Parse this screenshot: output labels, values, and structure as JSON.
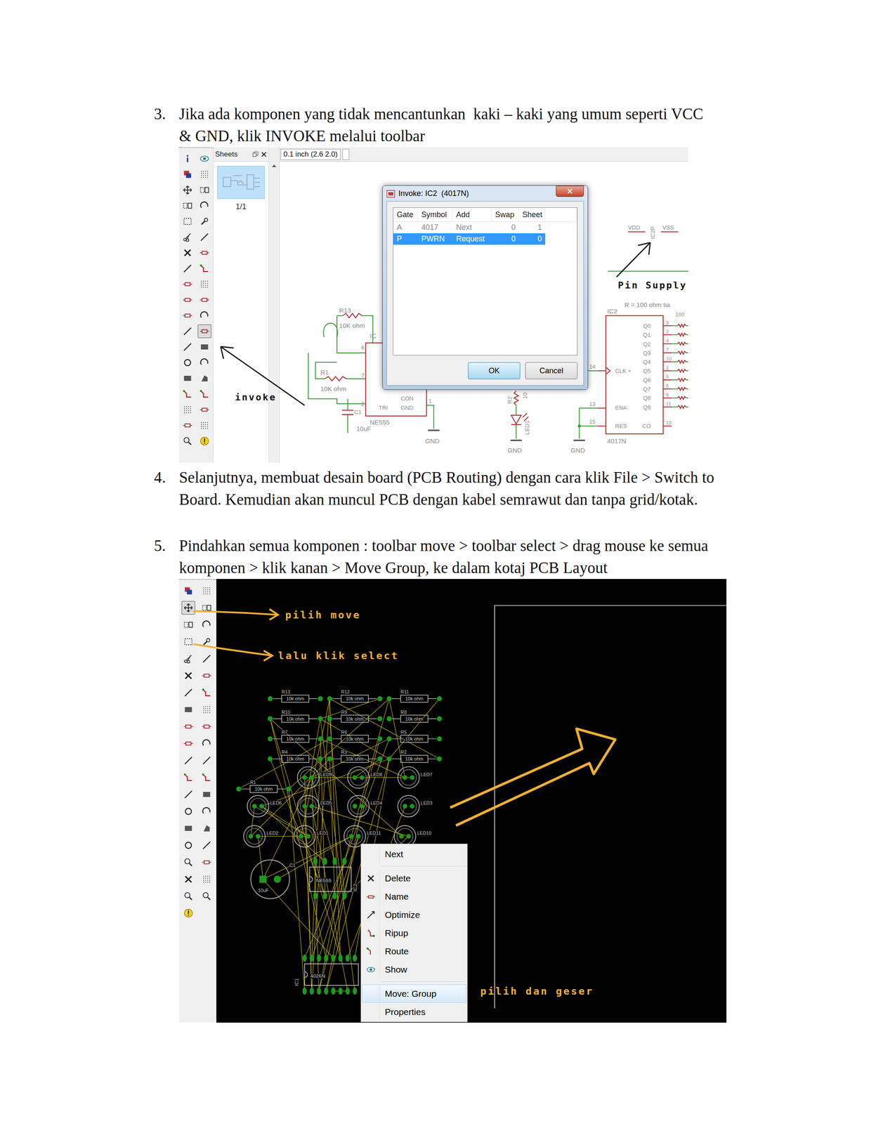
{
  "steps": [
    {
      "number": "3.",
      "lines": [
        "Jika ada komponen yang tidak mencantunkan  kaki – kaki yang umum seperti VCC",
        "& GND, klik INVOKE melalui toolbar"
      ]
    },
    {
      "number": "4.",
      "lines": [
        "Selanjutnya, membuat desain board (PCB Routing) dengan cara klik File > Switch to",
        "Board. Kemudian akan muncul PCB dengan kabel semrawut dan tanpa grid/kotak."
      ]
    },
    {
      "number": "5.",
      "lines": [
        "Pindahkan semua komponen : toolbar move > toolbar select > drag mouse ke semua",
        "komponen > klik kanan > Move Group, ke dalam kotaj PCB Layout"
      ]
    }
  ],
  "schematic_screenshot": {
    "toolbar": [
      {
        "selected": false
      },
      {
        "selected": false
      },
      {
        "selected": false
      },
      {
        "selected": false
      },
      {
        "selected": false
      },
      {
        "selected": false
      },
      {
        "selected": false
      },
      {
        "selected": false
      },
      {
        "selected": false
      },
      {
        "selected": false
      },
      {
        "selected": false
      },
      {
        "selected": false
      },
      {
        "selected": false
      },
      {
        "selected": false
      },
      {
        "selected": false
      },
      {
        "selected": false
      },
      {
        "selected": false
      },
      {
        "selected": false
      },
      {
        "selected": false
      },
      {
        "selected": false
      },
      {
        "selected": false
      },
      {
        "selected": false
      },
      {
        "selected": false
      },
      {
        "selected": true
      },
      {
        "selected": false
      },
      {
        "selected": false
      },
      {
        "selected": false
      },
      {
        "selected": false
      },
      {
        "selected": false
      },
      {
        "selected": false
      },
      {
        "selected": false
      },
      {
        "selected": false
      },
      {
        "selected": false
      },
      {
        "selected": false
      },
      {
        "selected": false
      },
      {
        "selected": false
      },
      {
        "selected": false
      },
      {
        "selected": false
      }
    ],
    "sheets_panel": {
      "title": "Sheets",
      "page": "1/1",
      "thumbnail_selected": true
    },
    "coordinate": "0.1 inch (2.6 2.0)",
    "labels": [
      "R13",
      "10K ohm",
      "R1",
      "10K ohm",
      "IC",
      "6",
      "7",
      "2",
      "C1",
      "TRI",
      "CON",
      "GND",
      "1",
      "NE555",
      "10uF",
      "GND",
      "R2",
      "10",
      "LED1",
      "GND",
      "GND",
      "IC2",
      "R = 100 ohm tia",
      "Q0",
      "Q1",
      "Q2",
      "Q3",
      "Q4",
      "Q5",
      "Q6",
      "Q7",
      "Q8",
      "Q9",
      "CLK +",
      "ENA",
      "RES",
      "CO",
      "4017N",
      "14",
      "13",
      "15",
      "3",
      "2",
      "4",
      "7",
      "10",
      "1",
      "5",
      "6",
      "9",
      "11",
      "12",
      "100",
      "VDD",
      "IC2P",
      "VSS"
    ],
    "dialog": {
      "title": "Invoke: IC2  (4017N)",
      "columns": [
        "Gate",
        "Symbol",
        "Add",
        "Swap",
        "Sheet"
      ],
      "rows": [
        {
          "cells": [
            "A",
            "4017",
            "Next",
            "0",
            "1"
          ],
          "selected": false,
          "disabled": true
        },
        {
          "cells": [
            "P",
            "PWRN",
            "Request",
            "0",
            "0"
          ],
          "selected": true,
          "disabled": false
        }
      ],
      "buttons": [
        {
          "label": "OK",
          "focused": true
        },
        {
          "label": "Cancel",
          "focused": false
        }
      ]
    },
    "annotations": {
      "invoke": "invoke",
      "pin_supply": "Pin Supply"
    }
  },
  "board_screenshot": {
    "toolbar": [
      {
        "selected": false
      },
      {
        "selected": false
      },
      {
        "selected": true
      },
      {
        "selected": false
      },
      {
        "selected": false
      },
      {
        "selected": false
      },
      {
        "selected": false
      },
      {
        "selected": false
      },
      {
        "selected": false
      },
      {
        "selected": false
      },
      {
        "selected": false
      },
      {
        "selected": false
      },
      {
        "selected": false
      },
      {
        "selected": false
      },
      {
        "selected": false
      },
      {
        "selected": false
      },
      {
        "selected": false
      },
      {
        "selected": false
      },
      {
        "selected": false
      },
      {
        "selected": false
      },
      {
        "selected": false
      },
      {
        "selected": false
      },
      {
        "selected": false
      },
      {
        "selected": false
      },
      {
        "selected": false
      },
      {
        "selected": false
      },
      {
        "selected": false
      },
      {
        "selected": false
      },
      {
        "selected": false
      },
      {
        "selected": false
      },
      {
        "selected": false
      },
      {
        "selected": false
      },
      {
        "selected": false
      },
      {
        "selected": false
      },
      {
        "selected": false
      },
      {
        "selected": false
      },
      {
        "selected": false
      },
      {
        "selected": false
      },
      {
        "selected": false
      }
    ],
    "resistors": [
      {
        "name": "R13",
        "value": "10k ohm"
      },
      {
        "name": "R12",
        "value": "10k ohm"
      },
      {
        "name": "R11",
        "value": "10k ohm"
      },
      {
        "name": "R10",
        "value": "10k ohm"
      },
      {
        "name": "R9",
        "value": "10k ohm"
      },
      {
        "name": "R8",
        "value": "10k ohm"
      },
      {
        "name": "R7",
        "value": "10k ohm"
      },
      {
        "name": "R6",
        "value": "10k ohm"
      },
      {
        "name": "R5",
        "value": "10k ohm"
      },
      {
        "name": "R4",
        "value": "10k ohm"
      },
      {
        "name": "R3",
        "value": "10k ohm"
      },
      {
        "name": "R2",
        "value": "10k ohm"
      },
      {
        "name": "R1",
        "value": "10k ohm"
      }
    ],
    "leds": [
      "LED9",
      "LED8",
      "LED7",
      "LED6",
      "LED5",
      "LED4",
      "LED3",
      "LED2",
      "LED1",
      "LED11",
      "LED10"
    ],
    "capacitor": {
      "name": "C1",
      "value": "10uF"
    },
    "ics": [
      {
        "name": "IC2",
        "value": "NE555"
      },
      {
        "name": "IC1",
        "value": "4026N"
      }
    ],
    "context_menu": [
      {
        "kind": "item",
        "label": "Next",
        "selected": false
      },
      {
        "kind": "separator"
      },
      {
        "kind": "item",
        "label": "Delete",
        "selected": false
      },
      {
        "kind": "item",
        "label": "Name",
        "selected": false
      },
      {
        "kind": "item",
        "label": "Optimize",
        "selected": false
      },
      {
        "kind": "item",
        "label": "Ripup",
        "selected": false
      },
      {
        "kind": "item",
        "label": "Route",
        "selected": false
      },
      {
        "kind": "item",
        "label": "Show",
        "selected": false
      },
      {
        "kind": "separator"
      },
      {
        "kind": "item",
        "label": "Move: Group",
        "selected": true
      },
      {
        "kind": "item",
        "label": "Properties",
        "selected": false
      }
    ],
    "annotations": [
      "pilih move",
      "lalu klik select",
      "pilih dan geser"
    ]
  }
}
